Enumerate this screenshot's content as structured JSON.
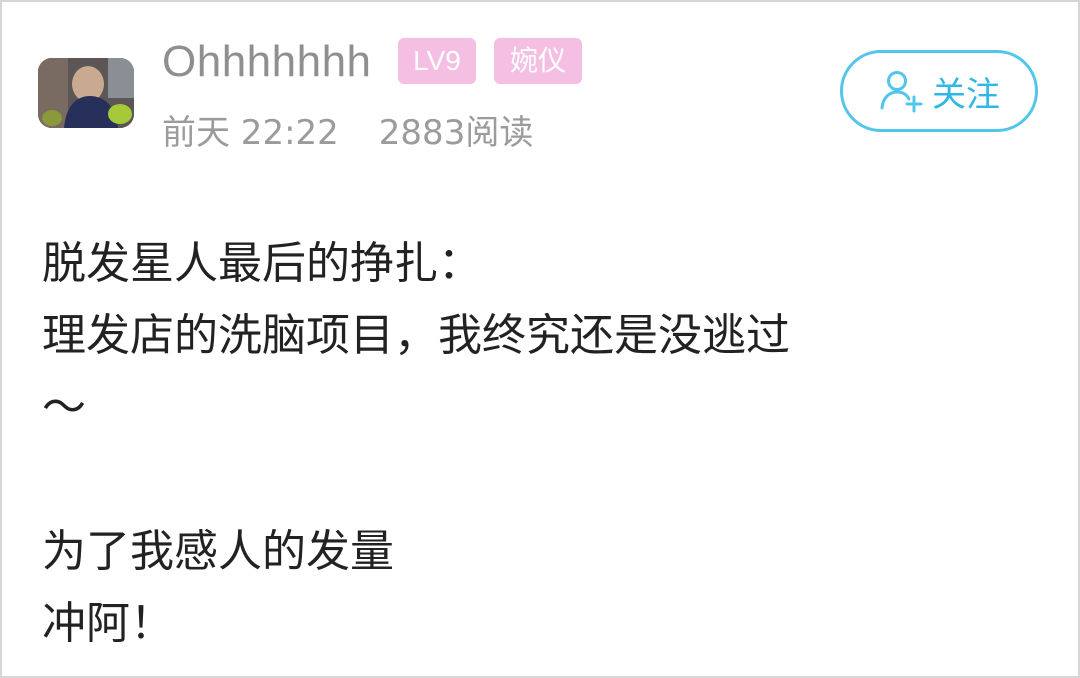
{
  "post": {
    "author": {
      "username": "Ohhhhhhh",
      "level_badge": "LV9",
      "title_badge": "婉仪"
    },
    "meta": {
      "time": "前天 22:22",
      "reads": "2883阅读"
    },
    "follow_button": {
      "label": "关注",
      "icon": "add-user-icon"
    },
    "content_lines": [
      "脱发星人最后的挣扎：",
      "理发店的洗脑项目，我终究还是没逃过",
      "～",
      "",
      "为了我感人的发量",
      "冲阿！"
    ]
  },
  "colors": {
    "badge_bg": "#f5bfe4",
    "follow_accent": "#52c6ea",
    "meta_text": "#9b9b9b",
    "username_text": "#8f8f8f"
  }
}
